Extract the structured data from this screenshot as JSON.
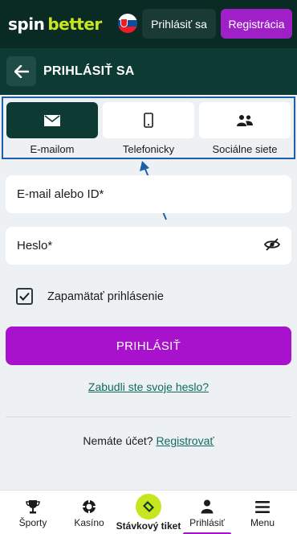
{
  "brand": {
    "part1": "spin",
    "part2": "better",
    "colors": {
      "dark": "#0a2a24",
      "header": "#0d3b33",
      "lime": "#c8e620",
      "purple": "#a812cc",
      "link": "#0f6a5f",
      "annotation": "#1d5fa8"
    }
  },
  "topbar": {
    "login_label": "Prihlásiť sa",
    "register_label": "Registrácia",
    "language_icon": "slovakia-flag-icon"
  },
  "header": {
    "title": "PRIHLÁSIŤ SA",
    "back_icon": "arrow-left-icon"
  },
  "tabs": [
    {
      "label": "E-mailom",
      "icon": "envelope-icon",
      "active": true
    },
    {
      "label": "Telefonicky",
      "icon": "smartphone-icon",
      "active": false
    },
    {
      "label": "Sociálne siete",
      "icon": "users-icon",
      "active": false
    }
  ],
  "form": {
    "email_placeholder": "E-mail alebo ID*",
    "password_placeholder": "Heslo*",
    "remember_label": "Zapamätať prihlásenie",
    "remember_checked": true,
    "submit_label": "PRIHLÁSIŤ",
    "forgot_label": "Zabudli ste svoje heslo?",
    "no_account_text": "Nemáte účet?",
    "register_link": "Registrovať"
  },
  "bottom_nav": [
    {
      "label": "Športy",
      "icon": "trophy-icon"
    },
    {
      "label": "Kasíno",
      "icon": "casino-chip-icon"
    },
    {
      "label": "Stávkový tiket",
      "icon": "ticket-icon"
    },
    {
      "label": "Prihlásiť",
      "icon": "user-icon",
      "active": true
    },
    {
      "label": "Menu",
      "icon": "hamburger-icon"
    }
  ]
}
